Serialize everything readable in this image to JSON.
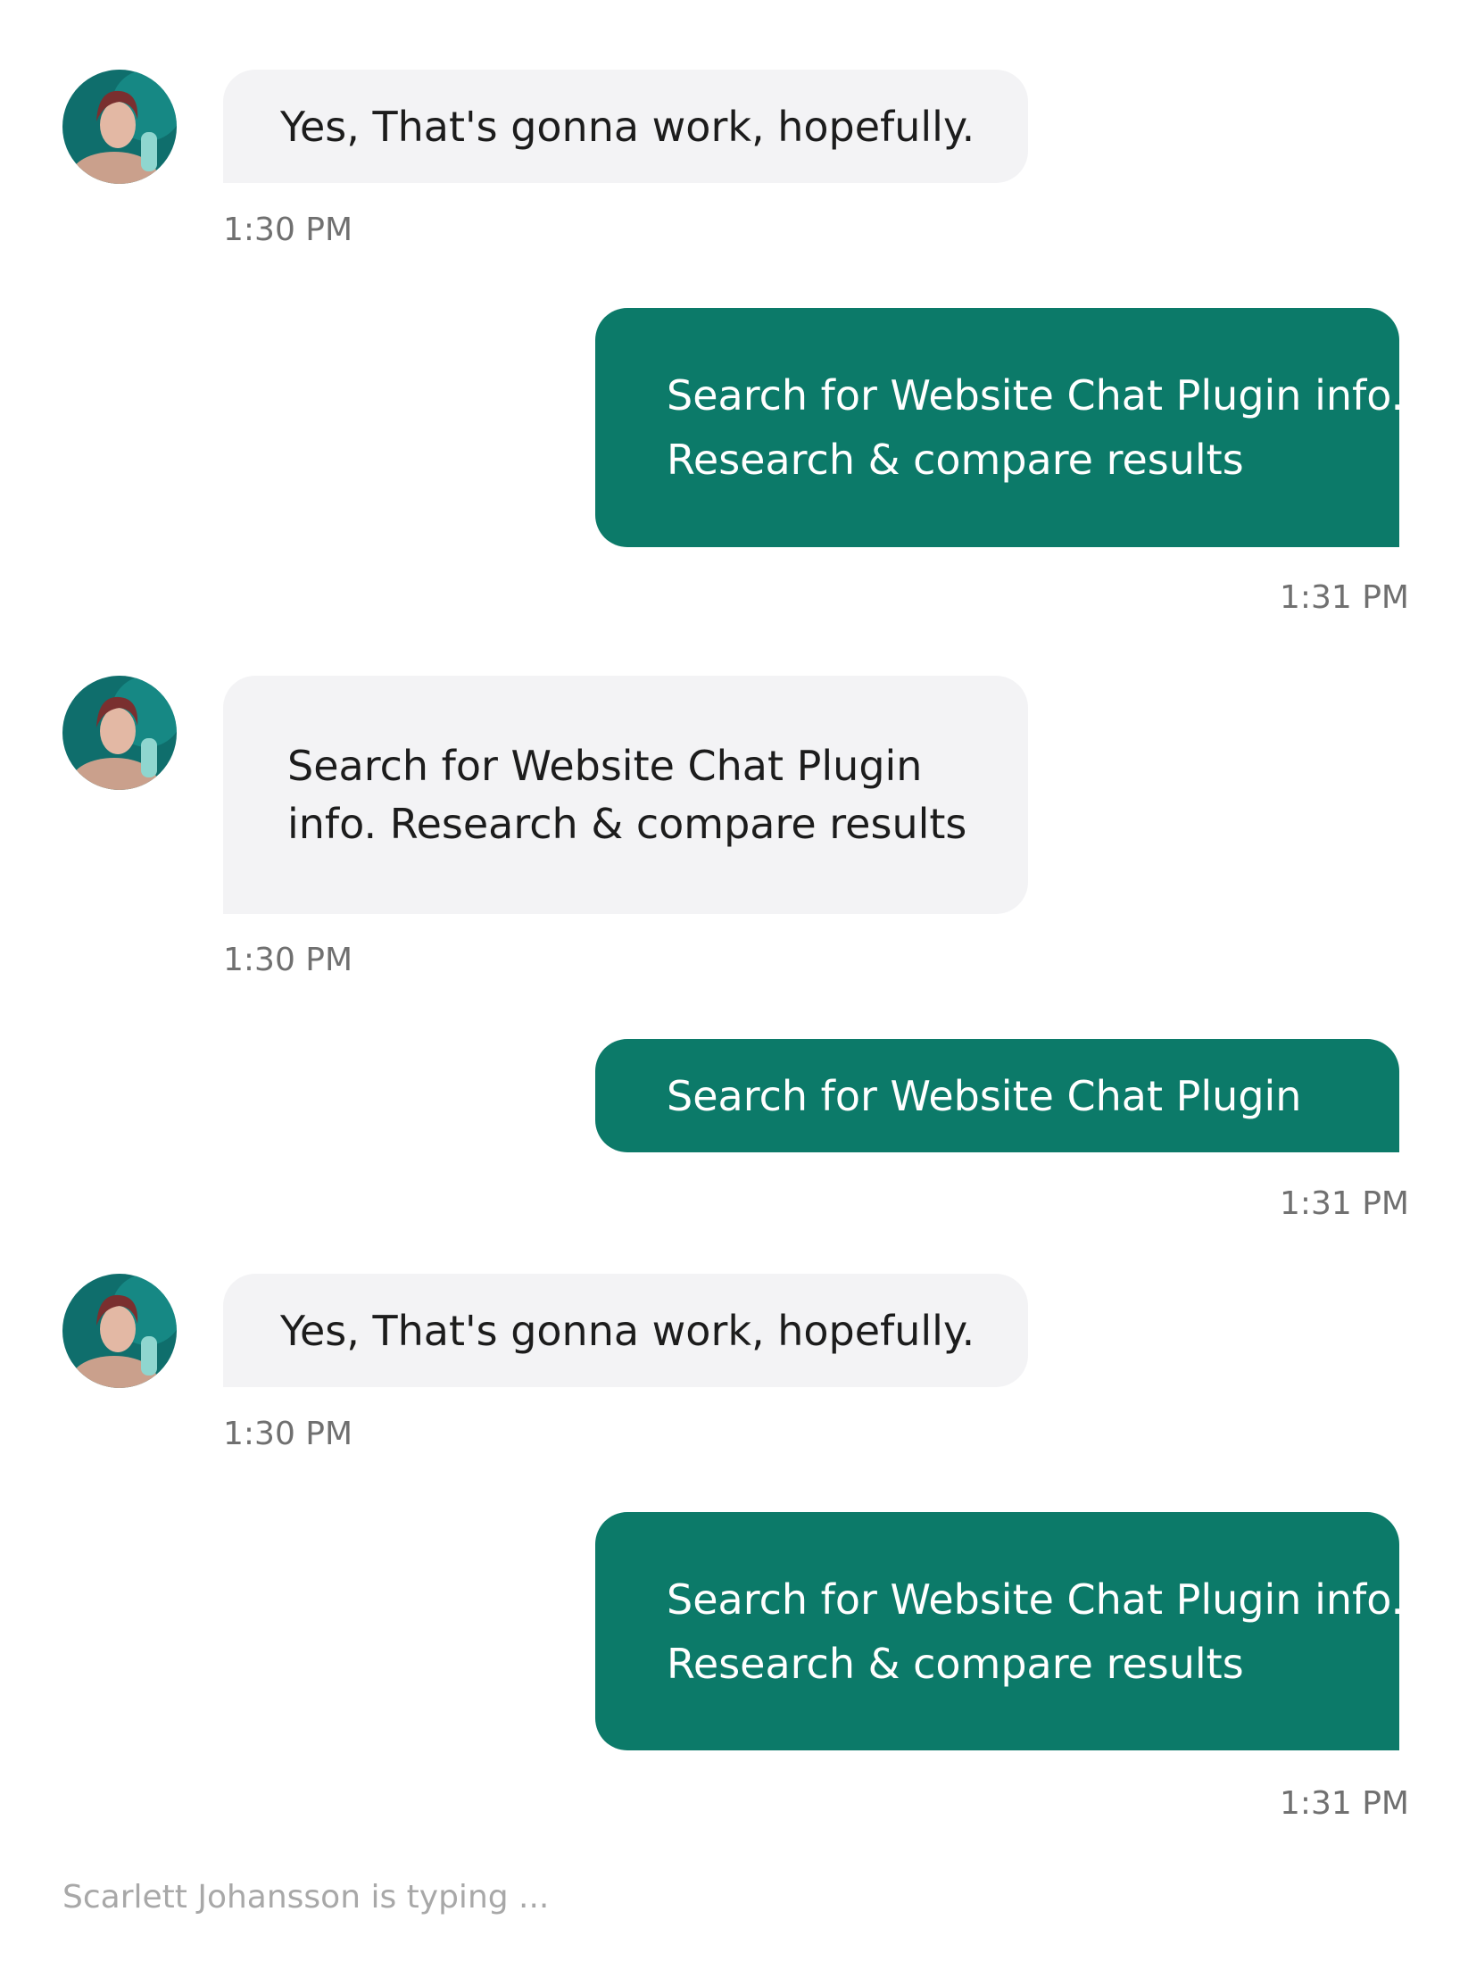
{
  "colors": {
    "incoming_bubble": "#f3f3f5",
    "outgoing_bubble": "#0c7a69",
    "timestamp": "#707070",
    "typing_text": "#a8a8a8"
  },
  "contact": {
    "avatar_icon": "contact-avatar-photo"
  },
  "messages": [
    {
      "direction": "incoming",
      "lines": [
        "Yes, That's gonna work, hopefully."
      ],
      "time": "1:30 PM"
    },
    {
      "direction": "outgoing",
      "lines": [
        "Search for Website Chat Plugin info.",
        "Research & compare results"
      ],
      "time": "1:31 PM"
    },
    {
      "direction": "incoming",
      "lines": [
        "Search for Website Chat Plugin",
        "info. Research & compare results"
      ],
      "time": "1:30 PM"
    },
    {
      "direction": "outgoing",
      "lines": [
        "Search for Website Chat Plugin"
      ],
      "time": "1:31 PM"
    },
    {
      "direction": "incoming",
      "lines": [
        "Yes, That's gonna work, hopefully."
      ],
      "time": "1:30 PM"
    },
    {
      "direction": "outgoing",
      "lines": [
        "Search for Website Chat Plugin info.",
        "Research & compare results"
      ],
      "time": "1:31 PM"
    }
  ],
  "typing_indicator": "Scarlett Johansson is typing ..."
}
